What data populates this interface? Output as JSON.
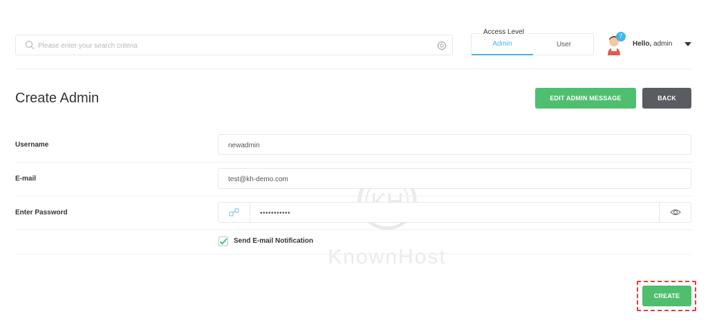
{
  "search": {
    "placeholder": "Please enter your search criteria"
  },
  "access_level": {
    "legend": "Access Level",
    "options": [
      "Admin",
      "User"
    ],
    "selected": "Admin"
  },
  "user_menu": {
    "notification_count": "7",
    "hello": "Hello,",
    "username": "admin"
  },
  "page": {
    "title": "Create Admin"
  },
  "actions": {
    "edit_admin_message": "EDIT ADMIN MESSAGE",
    "back": "BACK",
    "create": "CREATE"
  },
  "form": {
    "username": {
      "label": "Username",
      "value": "newadmin"
    },
    "email": {
      "label": "E-mail",
      "value": "test@kh-demo.com"
    },
    "password": {
      "label": "Enter Password",
      "value": "•••••••••••"
    },
    "notification": {
      "label": "Send E-mail Notification",
      "checked": true
    }
  },
  "watermark": {
    "text": "KnownHost"
  },
  "colors": {
    "accent": "#45b5e8",
    "success": "#4fbf6f",
    "dark_button": "#595c60",
    "highlight": "#e53935"
  }
}
